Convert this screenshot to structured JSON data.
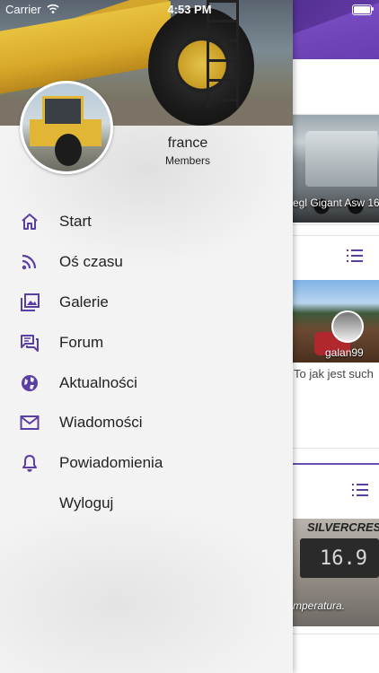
{
  "status_bar": {
    "carrier": "Carrier",
    "time": "4:53 PM"
  },
  "profile": {
    "name": "france",
    "role": "Members"
  },
  "menu": [
    {
      "label": "Start",
      "icon": "home-icon"
    },
    {
      "label": "Oś czasu",
      "icon": "rss-icon"
    },
    {
      "label": "Galerie",
      "icon": "gallery-icon"
    },
    {
      "label": "Forum",
      "icon": "forum-icon"
    },
    {
      "label": "Aktualności",
      "icon": "globe-icon"
    },
    {
      "label": "Wiadomości",
      "icon": "envelope-icon"
    },
    {
      "label": "Powiadomienia",
      "icon": "bell-icon"
    },
    {
      "label": "Wyloguj",
      "icon": ""
    }
  ],
  "background_feed": {
    "card1_caption": "egl Gigant Asw 16",
    "card2_user": "galan99",
    "card2_comment": "To jak jest such",
    "card3_brand": "SILVERCREST",
    "card3_digits": "16.9",
    "card3_caption": "mperatura."
  },
  "colors": {
    "accent": "#5b3da6",
    "header": "#4b2a86"
  }
}
